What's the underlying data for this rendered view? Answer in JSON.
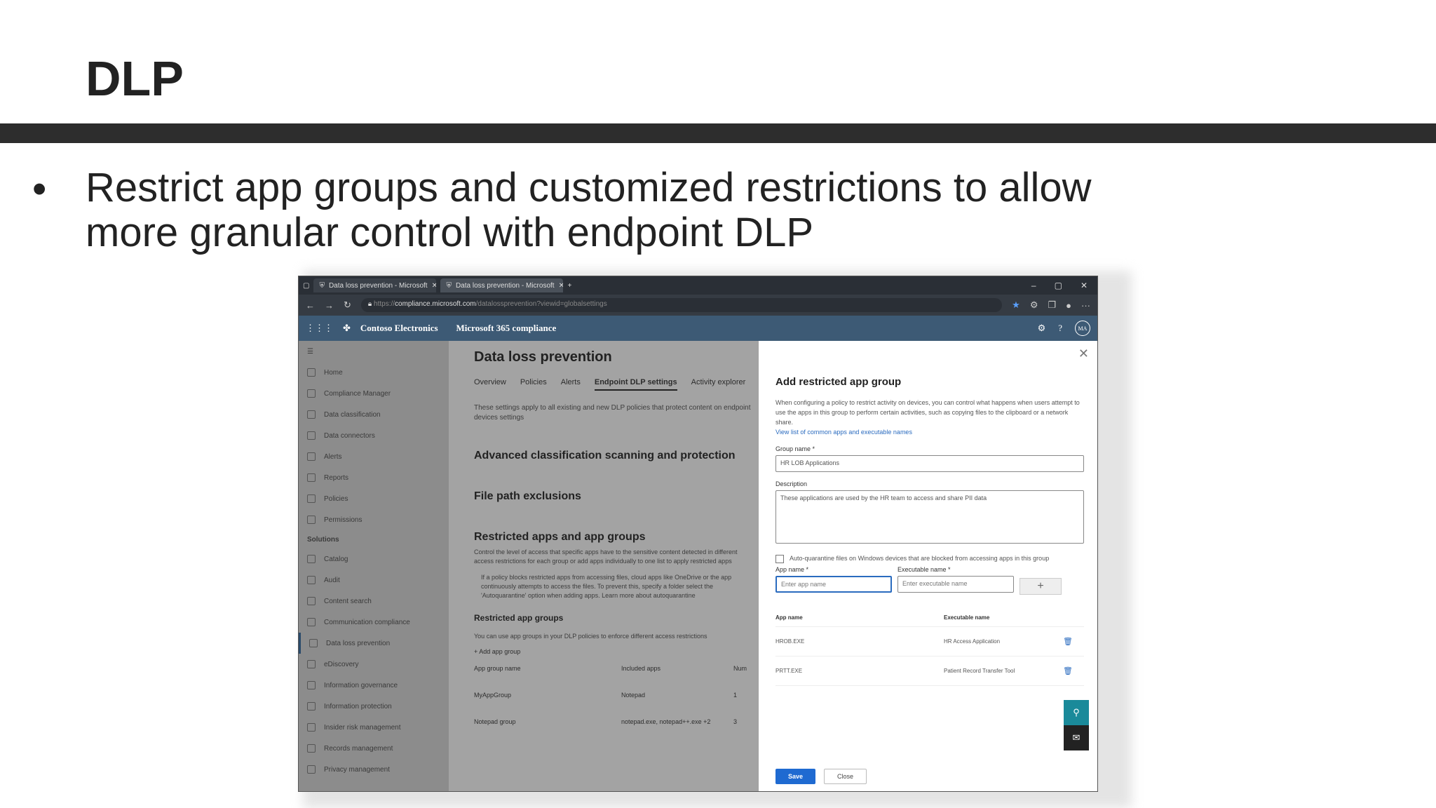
{
  "slide": {
    "title": "DLP",
    "bullet": "Restrict app groups and customized restrictions to allow more granular control with endpoint DLP"
  },
  "browser": {
    "tabs": [
      {
        "label": "Data loss prevention - Microsoft"
      },
      {
        "label": "Data loss prevention - Microsoft"
      }
    ],
    "url_prefix": "https://",
    "url_host": "compliance.microsoft.com",
    "url_path": "/datalossprevention?viewid=globalsettings"
  },
  "appbar": {
    "org": "Contoso Electronics",
    "product": "Microsoft 365 compliance",
    "avatar": "MA"
  },
  "nav": {
    "items": [
      "Home",
      "Compliance Manager",
      "Data classification",
      "Data connectors",
      "Alerts",
      "Reports",
      "Policies",
      "Permissions"
    ],
    "solutions_heading": "Solutions",
    "solutions": [
      "Catalog",
      "Audit",
      "Content search",
      "Communication compliance",
      "Data loss prevention",
      "eDiscovery",
      "Information governance",
      "Information protection",
      "Insider risk management",
      "Records management",
      "Privacy management"
    ]
  },
  "main": {
    "title": "Data loss prevention",
    "tabs": [
      "Overview",
      "Policies",
      "Alerts",
      "Endpoint DLP settings",
      "Activity explorer"
    ],
    "intro": "These settings apply to all existing and new DLP policies that protect content on endpoint devices settings",
    "section1": "Advanced classification scanning and protection",
    "section2": "File path exclusions",
    "section3": "Restricted apps and app groups",
    "section3_desc": "Control the level of access that specific apps have to the sensitive content detected in different access restrictions for each group or add apps individually to one list to apply restricted apps",
    "info": "If a policy blocks restricted apps from accessing files, cloud apps like OneDrive or the app continuously attempts to access the files. To prevent this, specify a folder select the 'Autoquarantine' option when adding apps. Learn more about autoquarantine",
    "section4": "Restricted app groups",
    "section4_desc": "You can use app groups in your DLP policies to enforce different access restrictions",
    "add_group": "Add app group",
    "table_headers": [
      "App group name",
      "Included apps",
      "Num"
    ],
    "table_rows": [
      [
        "MyAppGroup",
        "Notepad",
        "1"
      ],
      [
        "Notepad group",
        "notepad.exe, notepad++.exe +2",
        "3"
      ]
    ]
  },
  "panel": {
    "title": "Add restricted app group",
    "desc": "When configuring a policy to restrict activity on devices, you can control what happens when users attempt to use the apps in this group to perform certain activities, such as copying files to the clipboard or a network share.",
    "link": "View list of common apps and executable names",
    "group_name_label": "Group name *",
    "group_name_value": "HR LOB Applications",
    "description_label": "Description",
    "description_value": "These applications are used by the HR team to access and share PII data",
    "checkbox_label": "Auto-quarantine files on Windows devices that are blocked from accessing apps in this group",
    "app_name_label": "App name *",
    "app_name_placeholder": "Enter app name",
    "exec_name_label": "Executable name *",
    "exec_name_placeholder": "Enter executable name",
    "table_headers": [
      "App name",
      "Executable name"
    ],
    "rows": [
      [
        "HROB.EXE",
        "HR Access Application"
      ],
      [
        "PRTT.EXE",
        "Patient Record Transfer Tool"
      ]
    ],
    "save": "Save",
    "close": "Close"
  },
  "colors": {
    "rule": "#2d2d2d",
    "appbar": "#3d5a75",
    "primary": "#1f6ad1",
    "fab": "#1a8a9a"
  }
}
